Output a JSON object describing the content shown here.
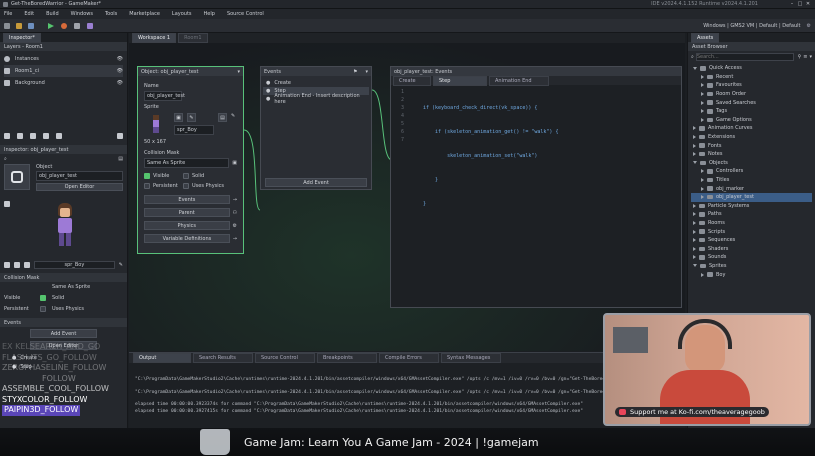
{
  "titlebar": {
    "title": "Get-TheBoredWarrior - GameMaker*",
    "right_info": "IDE v2024.4.1.152  Runtime v2024.4.1.201"
  },
  "menu": [
    "File",
    "Edit",
    "Build",
    "Windows",
    "Tools",
    "Marketplace",
    "Layouts",
    "Help",
    "Source Control"
  ],
  "toolbar": {
    "target_label": "Windows | GMS2 VM | Default | Default"
  },
  "left": {
    "inspector_tab": "Inspector*",
    "layers_title": "Layers - Room1",
    "layers": [
      "Instances",
      "Room1_ci",
      "Background"
    ],
    "inspector_title": "Inspector: obj_player_test",
    "object_section": "Object",
    "object_name": "obj_player_test",
    "open_editor": "Open Editor",
    "sprite_name": "spr_Boy",
    "collision_mask_title": "Collision Mask",
    "collision_mask_value": "Same As Sprite",
    "visible_label": "Visible",
    "solid_label": "Solid",
    "persistent_label": "Persistent",
    "uses_physics_label": "Uses Physics",
    "events_title": "Events",
    "add_event": "Add Event",
    "open_editor2": "Open Editor",
    "create_label": "Create",
    "step_label": "Step"
  },
  "chat_overlay": [
    "EX KELSEARCH_AND_GO",
    "FLASH.ITS_GO_FOLLOW",
    "ZEROPHASELINE_FOLLOW",
    "FOLLOW",
    "ASSEMBLE_COOL_FOLLOW",
    "STYXCOLOR_FOLLOW",
    "PAIPIN3D_FOLLOW"
  ],
  "workspace": {
    "tabs": [
      "Workspace 1",
      "Room1"
    ]
  },
  "object_panel": {
    "title": "Object: obj_player_test",
    "name_label": "Name",
    "name_value": "obj_player_test",
    "sprite_label": "Sprite",
    "sprite_value": "spr_Boy",
    "sprite_size": "50 x 167",
    "collision_mask_label": "Collision Mask",
    "collision_mask_value": "Same As Sprite",
    "visible": "Visible",
    "solid": "Solid",
    "persistent": "Persistent",
    "uses_physics": "Uses Physics",
    "btn_events": "Events",
    "btn_parent": "Parent",
    "btn_physics": "Physics",
    "btn_variables": "Variable Definitions"
  },
  "events_panel": {
    "title": "Events",
    "items": [
      "Create",
      "Step",
      "Animation End - Insert description here"
    ],
    "add_event": "Add Event"
  },
  "code_panel": {
    "title": "obj_player_test: Events",
    "tabs": [
      "Create",
      "Step",
      "Animation End"
    ],
    "line_numbers": [
      "1",
      "2",
      "3",
      "4",
      "5",
      "6",
      "7"
    ],
    "lines": [
      "if (keyboard_check_direct(vk_space)) {",
      "    if (skeleton_animation_get() != \"walk\") {",
      "        skeleton_animation_set(\"walk\")",
      "    }",
      "}",
      "",
      ""
    ]
  },
  "output": {
    "tabs": [
      "Output",
      "Search Results",
      "Source Control",
      "Breakpoints",
      "Compile Errors",
      "Syntax Messages"
    ],
    "lines": [
      "\"C:\\ProgramData\\GameMakerStudio2\\Cache\\runtimes\\runtime-2024.4.1.201/bin/assetcompiler/windows/x64/GMAssetCompiler.exe\"  /opts /c /mv=1 /iv=0 /rv=0 /bv=0 /gn=\"Get-TheBoredWarrior\" /td=\"C:\\Users\\Robert\\",
      "\"C:\\ProgramData\\GameMakerStudio2\\Cache\\runtimes\\runtime-2024.4.1.201/bin/assetcompiler/windows/x64/GMAssetCompiler.exe\"  /opts /c /mv=1 /iv=0 /rv=0 /bv=0 /gn=\"Get-TheBoredWarrior\" /td=\"C:\\Users\\Robert\\",
      "elapsed time 00:00:00.3923374s for command \"C:\\ProgramData\\GameMakerStudio2\\Cache\\runtimes\\runtime-2024.4.1.201/bin/assetcompiler/windows/x64/GMAssetCompiler.exe\"",
      "elapsed time 00:00:00.3927415s for command \"C:\\ProgramData\\GameMakerStudio2\\Cache\\runtimes\\runtime-2024.4.1.201/bin/assetcompiler/windows/x64/GMAssetCompiler.exe\""
    ]
  },
  "assets": {
    "tab": "Assets",
    "title": "Asset Browser",
    "search_placeholder": "Search...",
    "tree": [
      {
        "label": "Quick Access",
        "depth": 0,
        "open": true
      },
      {
        "label": "Recent",
        "depth": 1
      },
      {
        "label": "Favourites",
        "depth": 1
      },
      {
        "label": "Room Order",
        "depth": 1
      },
      {
        "label": "Saved Searches",
        "depth": 1
      },
      {
        "label": "Tags",
        "depth": 1
      },
      {
        "label": "Game Options",
        "depth": 1
      },
      {
        "label": "Animation Curves",
        "depth": 0
      },
      {
        "label": "Extensions",
        "depth": 0
      },
      {
        "label": "Fonts",
        "depth": 0
      },
      {
        "label": "Notes",
        "depth": 0
      },
      {
        "label": "Objects",
        "depth": 0,
        "open": true
      },
      {
        "label": "Controllers",
        "depth": 1
      },
      {
        "label": "Titles",
        "depth": 1
      },
      {
        "label": "obj_marker",
        "depth": 1
      },
      {
        "label": "obj_player_test",
        "depth": 1,
        "selected": true
      },
      {
        "label": "Particle Systems",
        "depth": 0
      },
      {
        "label": "Paths",
        "depth": 0
      },
      {
        "label": "Rooms",
        "depth": 0
      },
      {
        "label": "Scripts",
        "depth": 0
      },
      {
        "label": "Sequences",
        "depth": 0
      },
      {
        "label": "Shaders",
        "depth": 0
      },
      {
        "label": "Sounds",
        "depth": 0
      },
      {
        "label": "Sprites",
        "depth": 0,
        "open": true
      },
      {
        "label": "Boy",
        "depth": 1
      }
    ]
  },
  "webcam": {
    "banner": "Support me at Ko-fi.com/theaveragegoob"
  },
  "stream_bar": {
    "title": "Game Jam: Learn You A Game Jam - 2024 | !gamejam"
  },
  "colors": {
    "accent": "#1e7fd6",
    "bg": "#1b1e22",
    "panel": "#2a2d33",
    "green_border": "#58c17a",
    "kofi": "#e8455a"
  }
}
